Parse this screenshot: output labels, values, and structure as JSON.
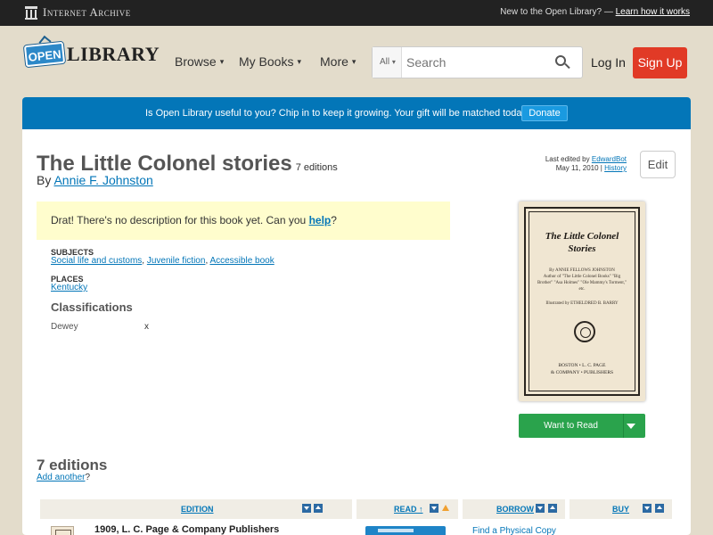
{
  "ia_bar": {
    "logo_text": "Internet Archive",
    "prompt": "New to the Open Library? —",
    "learn_link": "Learn how it works"
  },
  "header": {
    "logo_open": "OPEN",
    "logo_library": "LIBRARY",
    "nav": {
      "browse": "Browse",
      "my_books": "My Books",
      "more": "More"
    },
    "search": {
      "scope": "All",
      "placeholder": "Search"
    },
    "login": "Log In",
    "signup": "Sign Up"
  },
  "donate": {
    "message": "Is Open Library useful to you? Chip in to keep it growing. Your gift will be matched today!",
    "button": "Donate"
  },
  "work": {
    "title": "The Little Colonel stories",
    "edition_count": "7 editions",
    "by": "By",
    "author": "Annie F. Johnston",
    "last_edited_prefix": "Last edited by",
    "last_edited_by": "EdwardBot",
    "last_edited_date": "May 11, 2010",
    "history": "History",
    "edit_button": "Edit",
    "no_description": "Drat! There's no description for this book yet. Can you",
    "help_link": "help",
    "question": "?"
  },
  "subjects": {
    "heading": "SUBJECTS",
    "items": [
      "Social life and customs",
      "Juvenile fiction",
      "Accessible book"
    ]
  },
  "places": {
    "heading": "PLACES",
    "items": [
      "Kentucky"
    ]
  },
  "classifications": {
    "heading": "Classifications",
    "dewey_label": "Dewey",
    "dewey_value": "x"
  },
  "cover": {
    "title_line1": "The Little Colonel",
    "title_line2": "Stories",
    "byline": "By ANNIE FELLOWS JOHNSTON",
    "author_of": "Author of \"The Little Colonel Books\" \"Big Brother\" \"Asa Holmes\" \"Ole Mammy's Torment,\" etc.",
    "illustrated": "Illustrated by ETHELDRED B. BARRY",
    "pub_line1": "BOSTON • L. C. PAGE",
    "pub_line2": "& COMPANY • PUBLISHERS"
  },
  "want_to_read": "Want to Read",
  "editions": {
    "heading": "7 editions",
    "add_another": "Add another",
    "add_suffix": "?",
    "columns": {
      "edition": "EDITION",
      "read": "READ ↑",
      "borrow": "BORROW",
      "buy": "BUY"
    },
    "rows": [
      {
        "title": "1909, L. C. Page & Company Publishers",
        "borrow": "Find a Physical Copy"
      }
    ]
  }
}
